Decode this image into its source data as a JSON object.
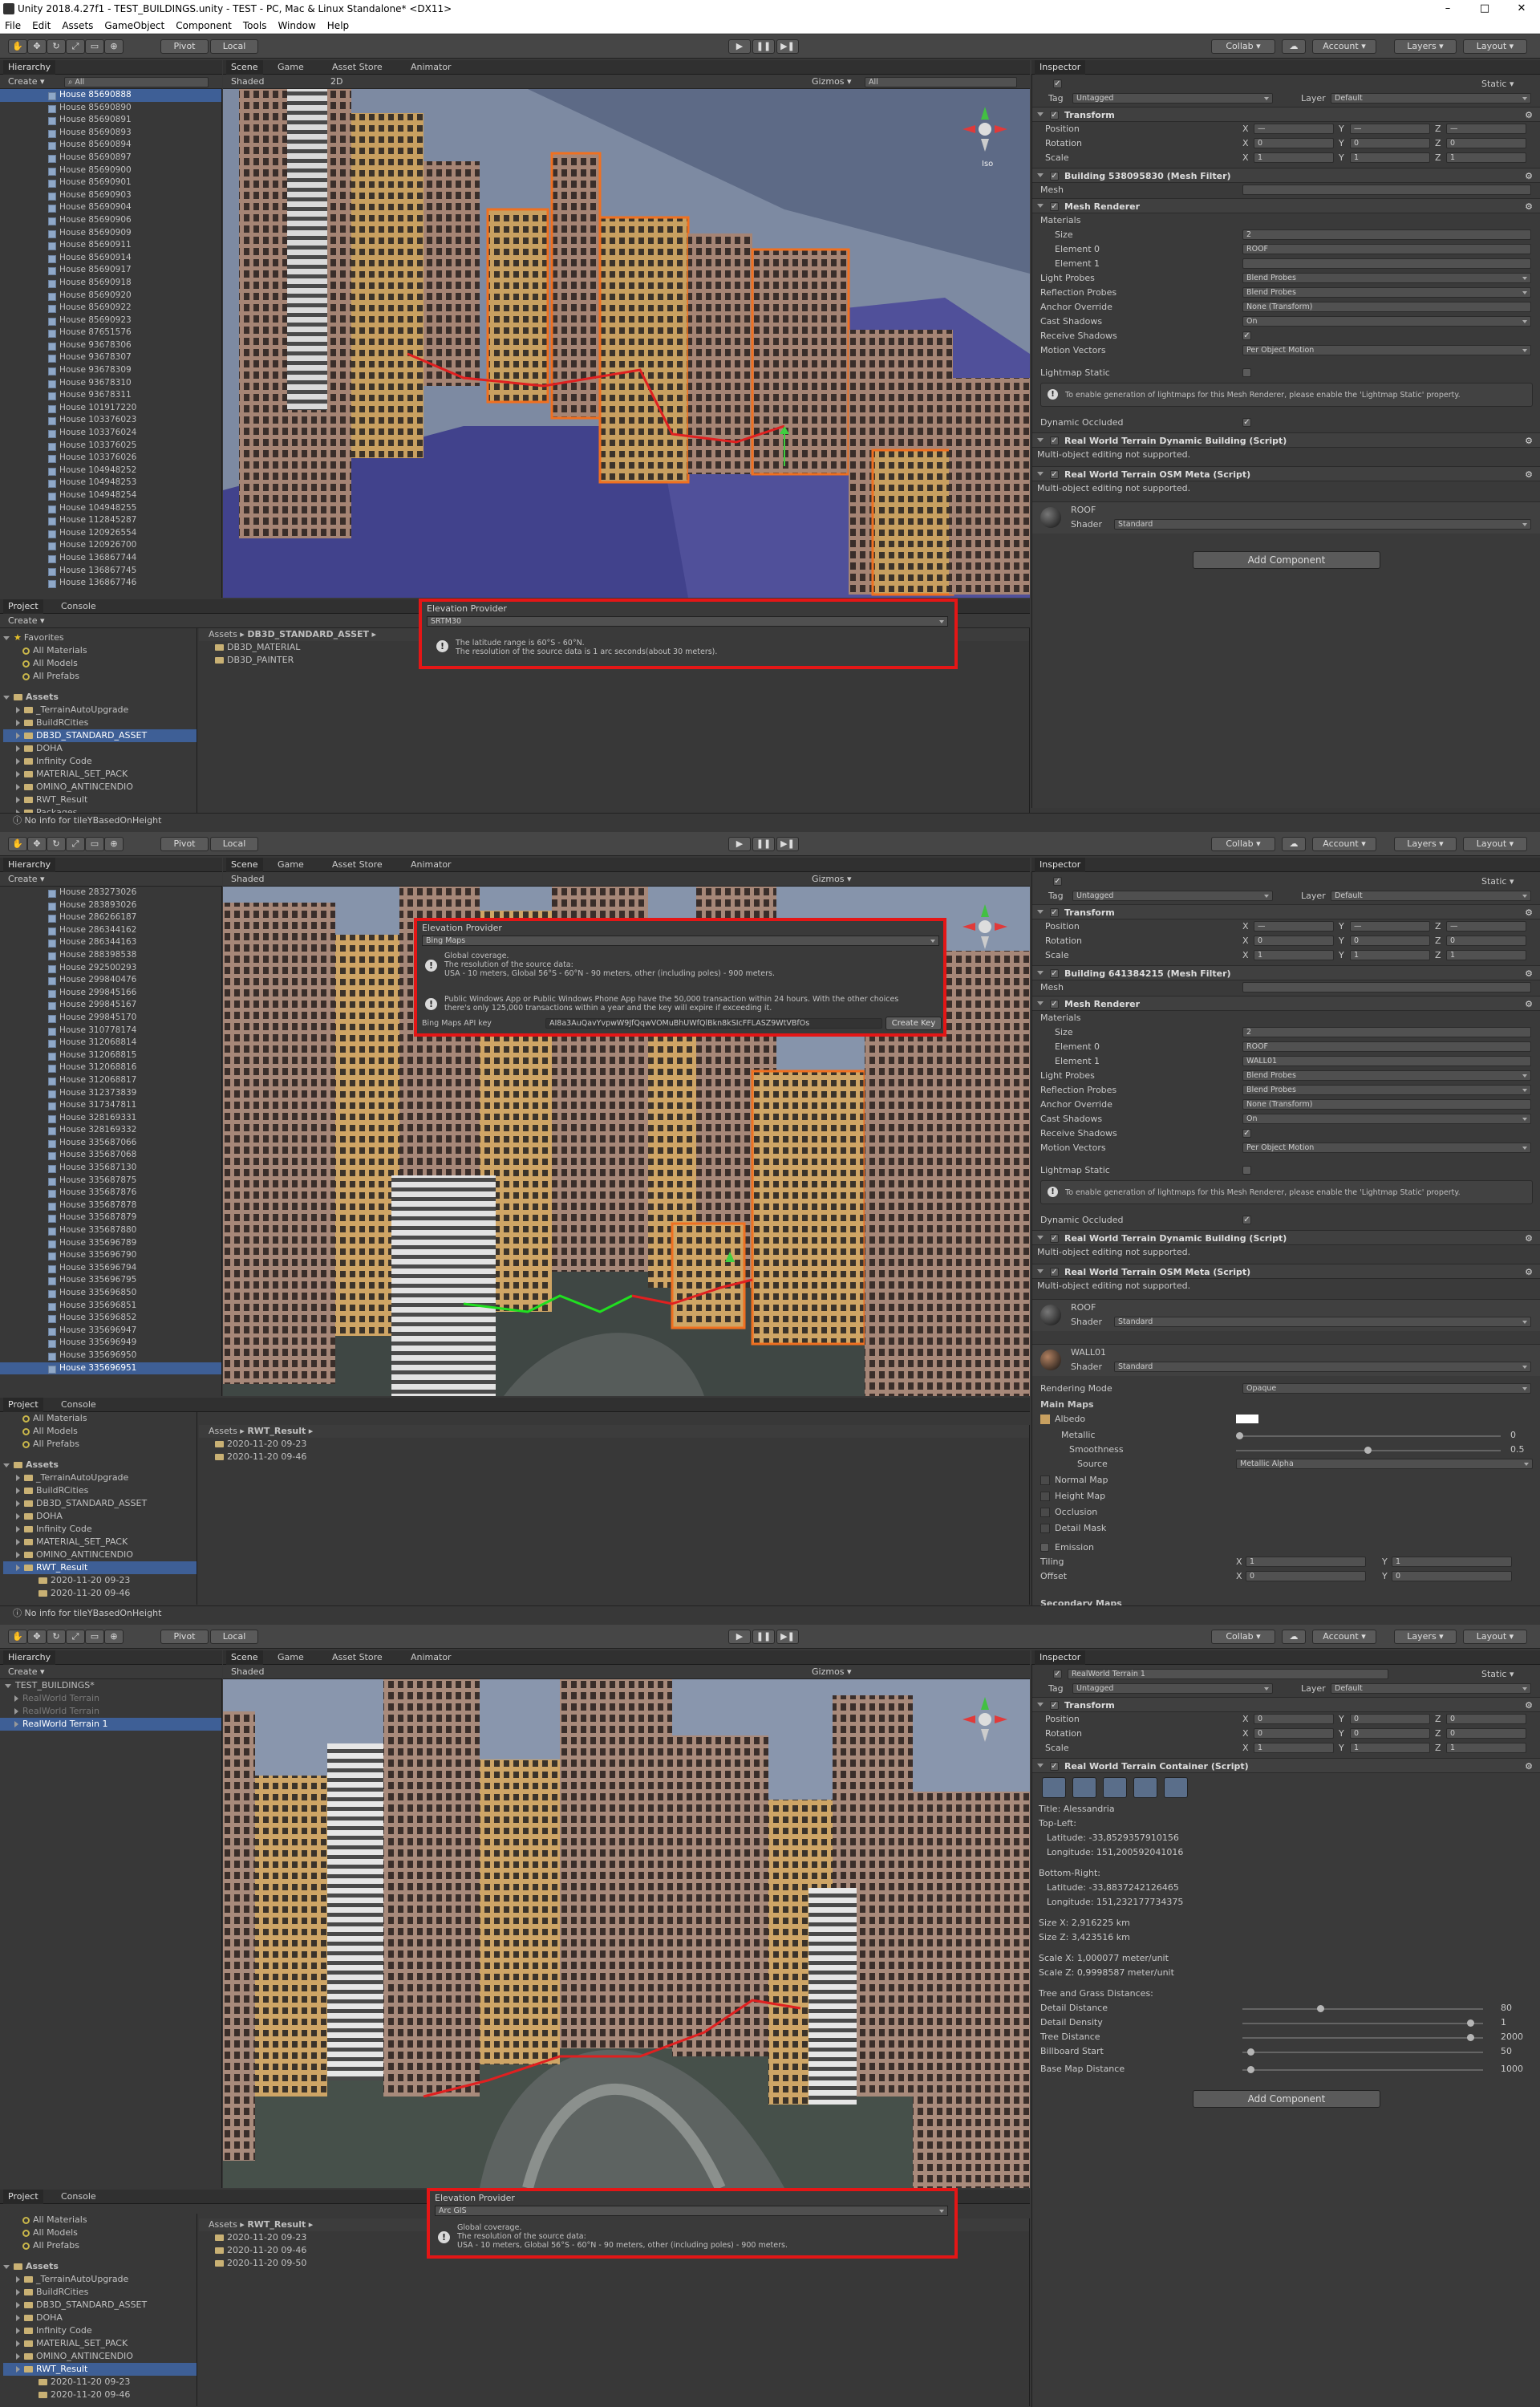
{
  "window_title": "Unity 2018.4.27f1 - TEST_BUILDINGS.unity - TEST - PC, Mac & Linux Standalone* <DX11>",
  "menu": [
    "File",
    "Edit",
    "Assets",
    "GameObject",
    "Component",
    "Tools",
    "Window",
    "Help"
  ],
  "toolbar": {
    "pivot": "Pivot",
    "local": "Local",
    "collab": "Collab ▾",
    "account": "Account ▾",
    "layers": "Layers ▾",
    "layout": "Layout ▾"
  },
  "tabs": {
    "hierarchy": "Hierarchy",
    "scene": "Scene",
    "game": "Game",
    "asset_store": "Asset Store",
    "animator": "Animator",
    "inspector": "Inspector",
    "project": "Project",
    "console": "Console",
    "create": "Create ▾",
    "all": "All",
    "shaded": "Shaded",
    "mode_2d": "2D",
    "gizmos": "Gizmos ▾",
    "persp": "Iso"
  },
  "p1": {
    "hierarchy": [
      "House 85690888",
      "House 85690890",
      "House 85690891",
      "House 85690893",
      "House 85690894",
      "House 85690897",
      "House 85690900",
      "House 85690901",
      "House 85690903",
      "House 85690904",
      "House 85690906",
      "House 85690909",
      "House 85690911",
      "House 85690914",
      "House 85690917",
      "House 85690918",
      "House 85690920",
      "House 85690922",
      "House 85690923",
      "House 87651576",
      "House 93678306",
      "House 93678307",
      "House 93678309",
      "House 93678310",
      "House 93678311",
      "House 101917220",
      "House 103376023",
      "House 103376024",
      "House 103376025",
      "House 103376026",
      "House 104948252",
      "House 104948253",
      "House 104948254",
      "House 104948255",
      "House 112845287",
      "House 120926554",
      "House 120926700",
      "House 136867744",
      "House 136867745",
      "House 136867746"
    ],
    "elevation": {
      "title": "Elevation Provider",
      "provider": "SRTM30",
      "info1": "The latitude range is 60°S - 60°N.",
      "info2": "The resolution of the source data is 1 arc seconds(about 30 meters)."
    },
    "project_tree": {
      "favorites": "Favorites",
      "fav_items": [
        "All Materials",
        "All Models",
        "All Prefabs"
      ],
      "assets": "Assets",
      "items": [
        "_TerrainAutoUpgrade",
        "BuildRCities",
        "DB3D_STANDARD_ASSET",
        "DOHA",
        "Infinity Code",
        "MATERIAL_SET_PACK",
        "OMINO_ANTINCENDIO",
        "RWT_Result",
        "Packages"
      ]
    },
    "breadcrumb": [
      "Assets",
      "DB3D_STANDARD_ASSET"
    ],
    "files": [
      "DB3D_MATERIAL",
      "DB3D_PAINTER"
    ],
    "inspector": {
      "tag_label": "Tag",
      "tag": "Untagged",
      "layer_label": "Layer",
      "layer": "Default",
      "static": "Static ▾",
      "transform": "Transform",
      "pos": "Position",
      "rot": "Rotation",
      "scale": "Scale",
      "x": "X",
      "y": "Y",
      "z": "Z",
      "pos_vals": [
        "—",
        "—",
        "—"
      ],
      "rot_vals": [
        "0",
        "0",
        "0"
      ],
      "scale_vals": [
        "1",
        "1",
        "1"
      ],
      "mesh_filter": "Building 538095830 (Mesh Filter)",
      "mesh": "Mesh",
      "mesh_renderer": "Mesh Renderer",
      "materials": "Materials",
      "size": "Size",
      "size_val": "2",
      "el0": "Element 0",
      "el0_val": "ROOF",
      "el1": "Element 1",
      "el1_val": "",
      "light_probes": "Light Probes",
      "light_probes_val": "Blend Probes",
      "refl": "Reflection Probes",
      "refl_val": "Blend Probes",
      "anchor": "Anchor Override",
      "anchor_val": "None (Transform)",
      "cast": "Cast Shadows",
      "cast_val": "On",
      "receive": "Receive Shadows",
      "motion": "Motion Vectors",
      "motion_val": "Per Object Motion",
      "lightmap": "Lightmap Static",
      "lightmap_info": "To enable generation of lightmaps for this Mesh Renderer, please enable the 'Lightmap Static' property.",
      "dyn_occ": "Dynamic Occluded",
      "rwt_dyn": "Real World Terrain Dynamic Building (Script)",
      "multi": "Multi-object editing not supported.",
      "rwt_osm": "Real World Terrain OSM Meta (Script)",
      "roof": "ROOF",
      "shader": "Shader",
      "shader_val": "Standard",
      "add_component": "Add Component"
    },
    "status": "No info for tileYBasedOnHeight"
  },
  "p2": {
    "hierarchy": [
      "House 283273026",
      "House 283893026",
      "House 286266187",
      "House 286344162",
      "House 286344163",
      "House 288398538",
      "House 292500293",
      "House 299840476",
      "House 299845166",
      "House 299845167",
      "House 299845170",
      "House 310778174",
      "House 312068814",
      "House 312068815",
      "House 312068816",
      "House 312068817",
      "House 312373839",
      "House 317347811",
      "House 328169331",
      "House 328169332",
      "House 335687066",
      "House 335687068",
      "House 335687130",
      "House 335687875",
      "House 335687876",
      "House 335687878",
      "House 335687879",
      "House 335687880",
      "House 335696789",
      "House 335696790",
      "House 335696794",
      "House 335696795",
      "House 335696850",
      "House 335696851",
      "House 335696852",
      "House 335696947",
      "House 335696949",
      "House 335696950",
      "House 335696951"
    ],
    "elevation": {
      "title": "Elevation Provider",
      "provider": "Bing Maps",
      "info1": "Global coverage.",
      "info2": "The resolution of the source data:",
      "info3": "USA - 10 meters, Global 56°S - 60°N - 90 meters, other (including poles) - 900 meters.",
      "info4": "Public Windows App or Public Windows Phone App have the 50,000 transaction within 24 hours. With the other choices",
      "info5": "there's only 125,000 transactions within a year and the key will expire if exceeding it.",
      "key_label": "Bing Maps API key",
      "key": "AI8a3AuQavYvpwW9JfQqwVOMuBhUWfQlBkn8kSIcFFLASZ9WtVBfOs",
      "create_key": "Create Key"
    },
    "project_tree": {
      "fav_items": [
        "All Materials",
        "All Models",
        "All Prefabs"
      ],
      "assets": "Assets",
      "items": [
        "_TerrainAutoUpgrade",
        "BuildRCities",
        "DB3D_STANDARD_ASSET",
        "DOHA",
        "Infinity Code",
        "MATERIAL_SET_PACK",
        "OMINO_ANTINCENDIO",
        "RWT_Result"
      ],
      "sub": [
        "2020-11-20 09-23",
        "2020-11-20 09-46"
      ]
    },
    "breadcrumb": [
      "Assets",
      "RWT_Result"
    ],
    "files": [
      "2020-11-20 09-23",
      "2020-11-20 09-46"
    ],
    "inspector": {
      "mesh_filter": "Building 641384215 (Mesh Filter)",
      "el1_val": "WALL01",
      "wall": "WALL01",
      "rendering_mode": "Rendering Mode",
      "rendering_mode_val": "Opaque",
      "main_maps": "Main Maps",
      "albedo": "Albedo",
      "metallic": "Metallic",
      "metallic_val": "0",
      "smooth": "Smoothness",
      "smooth_val": "0.5",
      "source": "Source",
      "source_val": "Metallic Alpha",
      "normal": "Normal Map",
      "height": "Height Map",
      "occlusion": "Occlusion",
      "detail_mask": "Detail Mask",
      "emission": "Emission",
      "tiling": "Tiling",
      "offset": "Offset",
      "tiling_vals": [
        "1",
        "1"
      ],
      "offset_vals": [
        "0",
        "0"
      ],
      "secondary": "Secondary Maps"
    },
    "status": "No info for tileYBasedOnHeight"
  },
  "p3": {
    "hierarchy": [
      {
        "label": "TEST_BUILDINGS*",
        "dim": false,
        "sel": false,
        "root": true
      },
      {
        "label": "RealWorld Terrain",
        "dim": true,
        "sel": false,
        "root": false
      },
      {
        "label": "RealWorld Terrain",
        "dim": true,
        "sel": false,
        "root": false
      },
      {
        "label": "RealWorld Terrain 1",
        "dim": false,
        "sel": true,
        "root": false
      }
    ],
    "elevation": {
      "title": "Elevation Provider",
      "provider": "Arc GIS",
      "info1": "Global coverage.",
      "info2": "The resolution of the source data:",
      "info3": "USA - 10 meters, Global 56°S - 60°N - 90 meters, other (including poles) - 900 meters."
    },
    "project_tree": {
      "fav_items": [
        "All Materials",
        "All Models",
        "All Prefabs"
      ],
      "assets": "Assets",
      "items": [
        "_TerrainAutoUpgrade",
        "BuildRCities",
        "DB3D_STANDARD_ASSET",
        "DOHA",
        "Infinity Code",
        "MATERIAL_SET_PACK",
        "OMINO_ANTINCENDIO",
        "RWT_Result"
      ],
      "sub": [
        "2020-11-20 09-23",
        "2020-11-20 09-46"
      ]
    },
    "breadcrumb": [
      "Assets",
      "RWT_Result"
    ],
    "files": [
      "2020-11-20 09-23",
      "2020-11-20 09-46",
      "2020-11-20 09-50"
    ],
    "inspector": {
      "name": "RealWorld Terrain 1",
      "container": "Real World Terrain Container (Script)",
      "title": "Title: Alessandria",
      "top_left": "Top-Left:",
      "tl_lat": "Latitude: -33,8529357910156",
      "tl_lon": "Longitude: 151,200592041016",
      "bottom_right": "Bottom-Right:",
      "br_lat": "Latitude: -33,8837242126465",
      "br_lon": "Longitude: 151,232177734375",
      "size_x": "Size X: 2,916225 km",
      "size_z": "Size Z: 3,423516 km",
      "scale_x": "Scale X: 1,000077 meter/unit",
      "scale_z": "Scale Z: 0,9998587 meter/unit",
      "tree_grass": "Tree and Grass Distances:",
      "detail_dist": "Detail Distance",
      "detail_dist_val": "80",
      "detail_density": "Detail Density",
      "detail_density_val": "1",
      "tree_dist": "Tree Distance",
      "tree_dist_val": "2000",
      "billboard": "Billboard Start",
      "billboard_val": "50",
      "basemap": "Base Map Distance",
      "basemap_val": "1000",
      "add_component": "Add Component",
      "pos_vals": [
        "0",
        "0",
        "0"
      ]
    }
  },
  "colors": {
    "highlight": "#e41616",
    "selection": "#3e5f96",
    "panel": "#383838",
    "accent_orange": "#f07020"
  }
}
